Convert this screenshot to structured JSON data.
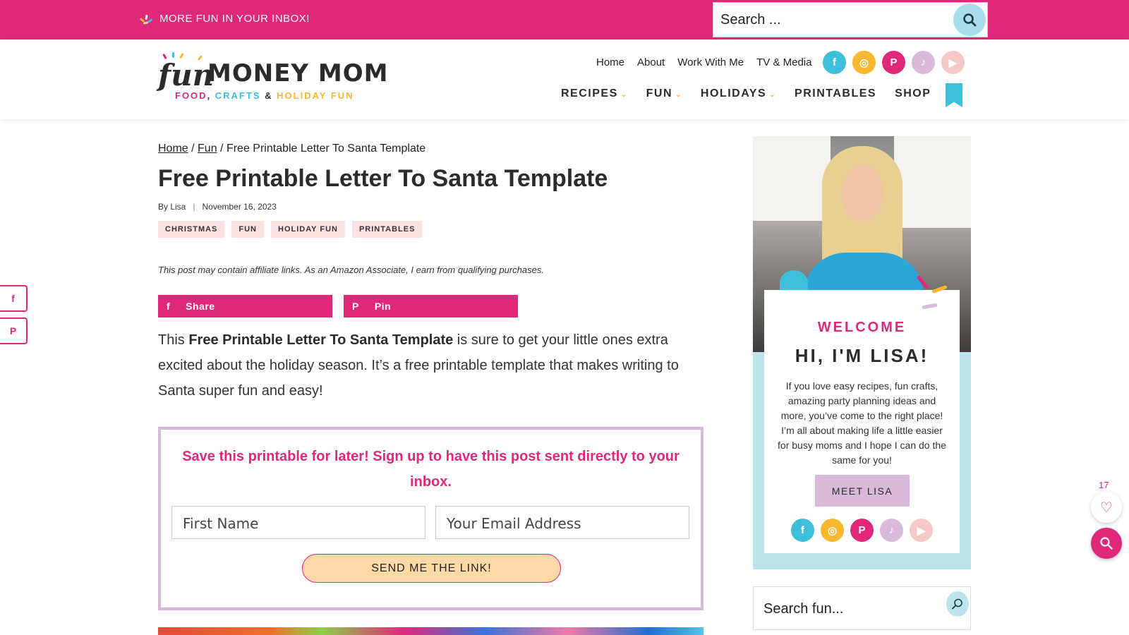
{
  "topbar": {
    "promo_text": "MORE FUN IN YOUR INBOX!",
    "search_placeholder": "Search ...",
    "color": "#e0287a"
  },
  "logo": {
    "word_fun": "fun",
    "word_main": "MONEY MOM",
    "tagline": [
      {
        "text": "FOOD",
        "color": "#e0287a"
      },
      {
        "text": ", ",
        "color": "#2b2b2b"
      },
      {
        "text": "CRAFTS",
        "color": "#3cbfd8"
      },
      {
        "text": " & ",
        "color": "#2b2b2b"
      },
      {
        "text": "HOLIDAY FUN",
        "color": "#f5b82e"
      }
    ]
  },
  "util_nav": [
    "Home",
    "About",
    "Work With Me",
    "TV & Media"
  ],
  "social_icons": [
    {
      "name": "facebook-icon",
      "glyph": "f"
    },
    {
      "name": "instagram-icon",
      "glyph": "◎"
    },
    {
      "name": "pinterest-icon",
      "glyph": "P"
    },
    {
      "name": "tiktok-icon",
      "glyph": "♪"
    },
    {
      "name": "youtube-icon",
      "glyph": "▶"
    }
  ],
  "main_nav": [
    {
      "label": "RECIPES",
      "dropdown": true
    },
    {
      "label": "FUN",
      "dropdown": true
    },
    {
      "label": "HOLIDAYS",
      "dropdown": true
    },
    {
      "label": "PRINTABLES",
      "dropdown": false
    },
    {
      "label": "SHOP",
      "dropdown": false
    }
  ],
  "breadcrumb": {
    "home": "Home",
    "sep1": " / ",
    "fun": "Fun",
    "sep2": " / ",
    "current": "Free Printable Letter To Santa Template"
  },
  "post": {
    "title": "Free Printable Letter To Santa Template",
    "author": "By Lisa",
    "divider": "|",
    "date": "November 16, 2023",
    "tags": [
      "CHRISTMAS",
      "FUN",
      "HOLIDAY FUN",
      "PRINTABLES"
    ],
    "disclaimer": "This post may contain affiliate links. As an Amazon Associate, I earn from qualifying purchases.",
    "share_label": "Share",
    "pin_label": "Pin",
    "intro_start": "This ",
    "intro_bold": "Free Printable Letter To Santa Template",
    "intro_rest": " is sure to get your little ones extra excited about the holiday season. It’s a free printable template that makes writing to Santa super fun and easy!"
  },
  "optin": {
    "heading": "Save this printable for later! Sign up to have this post sent directly to your inbox.",
    "first_name_placeholder": "First Name",
    "email_placeholder": "Your Email Address",
    "button_label": "SEND ME THE LINK!"
  },
  "sidebar": {
    "welcome": "WELCOME",
    "greeting": "HI, I'M LISA!",
    "bio": "If you love easy recipes, fun crafts, amazing party planning ideas and more, you’ve come to the right place! I’m all about making life a little easier for busy moms and I hope I can do the same for you!",
    "button_label": "MEET LISA",
    "search_placeholder": "Search fun..."
  },
  "floating": {
    "favorite_count": "17"
  },
  "colors": {
    "pink": "#e0287a",
    "teal": "#3cbfd8",
    "yellow": "#f5b82e",
    "lavender": "#d8b9d9",
    "light_blue": "#bde4ec"
  }
}
